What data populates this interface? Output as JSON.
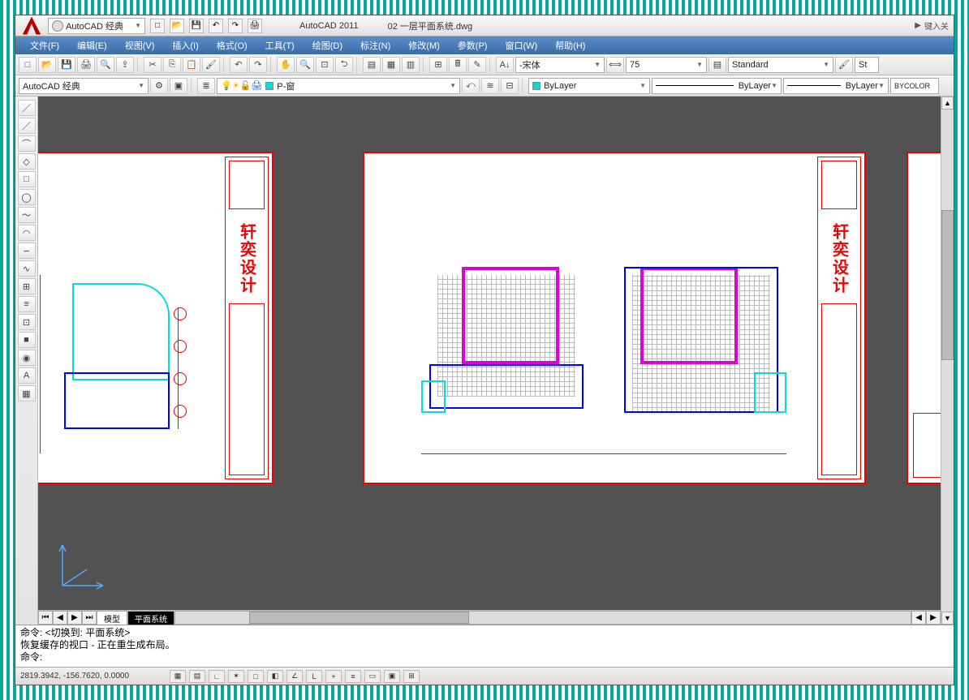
{
  "app": {
    "name": "AutoCAD 2011",
    "filename": "02 一层平面系统.dwg",
    "search_hint": "键入关"
  },
  "qat": {
    "workspace": "AutoCAD 经典"
  },
  "menu": {
    "file": "文件(F)",
    "edit": "编辑(E)",
    "view": "视图(V)",
    "insert": "插入(I)",
    "format": "格式(O)",
    "tools": "工具(T)",
    "draw": "绘图(D)",
    "dimension": "标注(N)",
    "modify": "修改(M)",
    "param": "参数(P)",
    "window": "窗口(W)",
    "help": "帮助(H)"
  },
  "row1": {
    "font": "-宋体",
    "size": "75",
    "style": "Standard",
    "style2": "St"
  },
  "row2": {
    "workspace": "AutoCAD 经典",
    "layer": "P-窗",
    "color": "ByLayer",
    "ltype": "ByLayer",
    "lweight": "ByLayer",
    "bycolor": "BYCOLOR"
  },
  "drawtools": [
    "／",
    "／",
    "⌒",
    "◇",
    "□",
    "◯",
    "～",
    "◠",
    "∽",
    "∿",
    "⊞",
    "≡",
    "⊡",
    "■",
    "◉",
    "A",
    "▦"
  ],
  "tabs": {
    "model": "模型",
    "layout1": "平面系统"
  },
  "cmd": {
    "line1": "命令:    <切换到: 平面系统>",
    "line2": "恢复缓存的视口 - 正在重生成布局。",
    "prompt": "命令:"
  },
  "status": {
    "coords": "2819.3942, -156.7620, 0.0000"
  },
  "sheet_logo": "轩奕设计"
}
